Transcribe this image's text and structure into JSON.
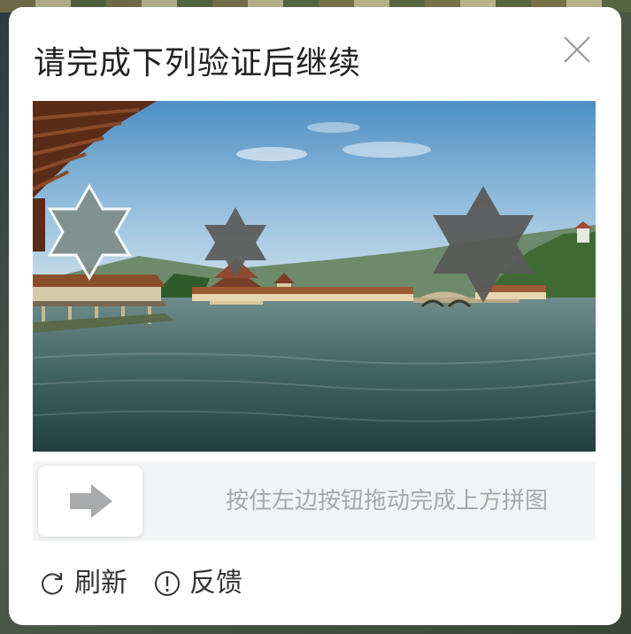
{
  "dialog": {
    "title": "请完成下列验证后继续",
    "close_icon": "close-icon"
  },
  "puzzle": {
    "image_subject": "lakeside pavilions and bridge scene",
    "piece_shape": "six-point-star",
    "piece_icon": "star-puzzle-piece"
  },
  "slider": {
    "hint": "按住左边按钮拖动完成上方拼图",
    "handle_icon": "arrow-right-icon",
    "progress": 0
  },
  "footer": {
    "refresh_label": "刷新",
    "refresh_icon": "refresh-icon",
    "feedback_label": "反馈",
    "feedback_icon": "info-circle-icon"
  },
  "colors": {
    "title_text": "#222222",
    "hint_text": "#a5a8ad",
    "track_bg": "#f2f3f5",
    "arrow": "#a9aaab"
  }
}
